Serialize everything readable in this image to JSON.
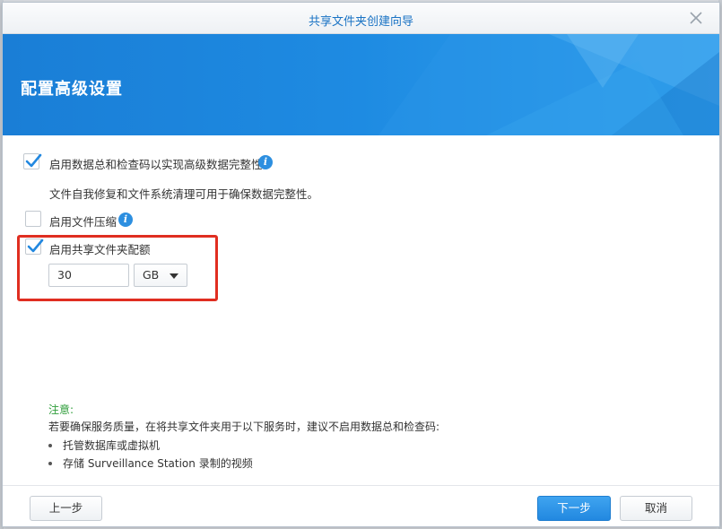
{
  "window": {
    "title": "共享文件夹创建向导",
    "close_icon": "close-icon"
  },
  "banner": {
    "heading": "配置高级设置"
  },
  "options": [
    {
      "label": "启用数据总和检查码以实现高级数据完整性",
      "checked": true,
      "info": true
    },
    {
      "description": "文件自我修复和文件系统清理可用于确保数据完整性。"
    },
    {
      "label": "启用文件压缩",
      "checked": false,
      "info": true
    },
    {
      "label": "启用共享文件夹配额",
      "checked": true,
      "info": false
    }
  ],
  "quota": {
    "value": "30",
    "unit": "GB"
  },
  "note": {
    "title": "注意:",
    "text": "若要确保服务质量，在将共享文件夹用于以下服务时，建议不启用数据总和检查码:",
    "items": [
      "托管数据库或虚拟机",
      "存储 Surveillance Station 录制的视频"
    ]
  },
  "footer": {
    "back_label": "上一步",
    "next_label": "下一步",
    "cancel_label": "取消"
  },
  "colors": {
    "accent": "#2288e0",
    "highlight_border": "#e02e21",
    "note_title": "#2e9d3a"
  }
}
